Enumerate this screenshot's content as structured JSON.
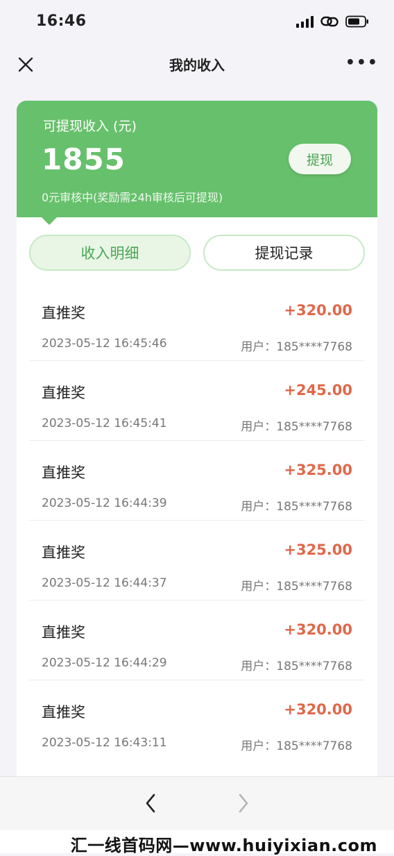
{
  "status": {
    "time": "16:46"
  },
  "nav": {
    "title": "我的收入"
  },
  "summary": {
    "label": "可提现收入 (元)",
    "amount": "1855",
    "note": "0元审核中(奖励需24h审核后可提现)",
    "withdraw_label": "提现"
  },
  "tabs": [
    {
      "label": "收入明细",
      "active": true
    },
    {
      "label": "提现记录",
      "active": false
    }
  ],
  "records": [
    {
      "title": "直推奖",
      "amount": "+320.00",
      "time": "2023-05-12 16:45:46",
      "user": "用户：185****7768"
    },
    {
      "title": "直推奖",
      "amount": "+245.00",
      "time": "2023-05-12 16:45:41",
      "user": "用户：185****7768"
    },
    {
      "title": "直推奖",
      "amount": "+325.00",
      "time": "2023-05-12 16:44:39",
      "user": "用户：185****7768"
    },
    {
      "title": "直推奖",
      "amount": "+325.00",
      "time": "2023-05-12 16:44:37",
      "user": "用户：185****7768"
    },
    {
      "title": "直推奖",
      "amount": "+320.00",
      "time": "2023-05-12 16:44:29",
      "user": "用户：185****7768"
    },
    {
      "title": "直推奖",
      "amount": "+320.00",
      "time": "2023-05-12 16:43:11",
      "user": "用户：185****7768"
    }
  ],
  "icons": {
    "signal": "signal-icon",
    "link": "link-icon",
    "battery": "battery-icon",
    "close": "close-icon",
    "more": "more-icon",
    "back": "chevron-left-icon",
    "forward": "chevron-right-icon"
  },
  "colors": {
    "header_green": "#67c06c",
    "amount_red": "#e0684a",
    "tab_active_text": "#4aa754"
  },
  "watermark": "汇一线首码网—www.huiyixian.com"
}
